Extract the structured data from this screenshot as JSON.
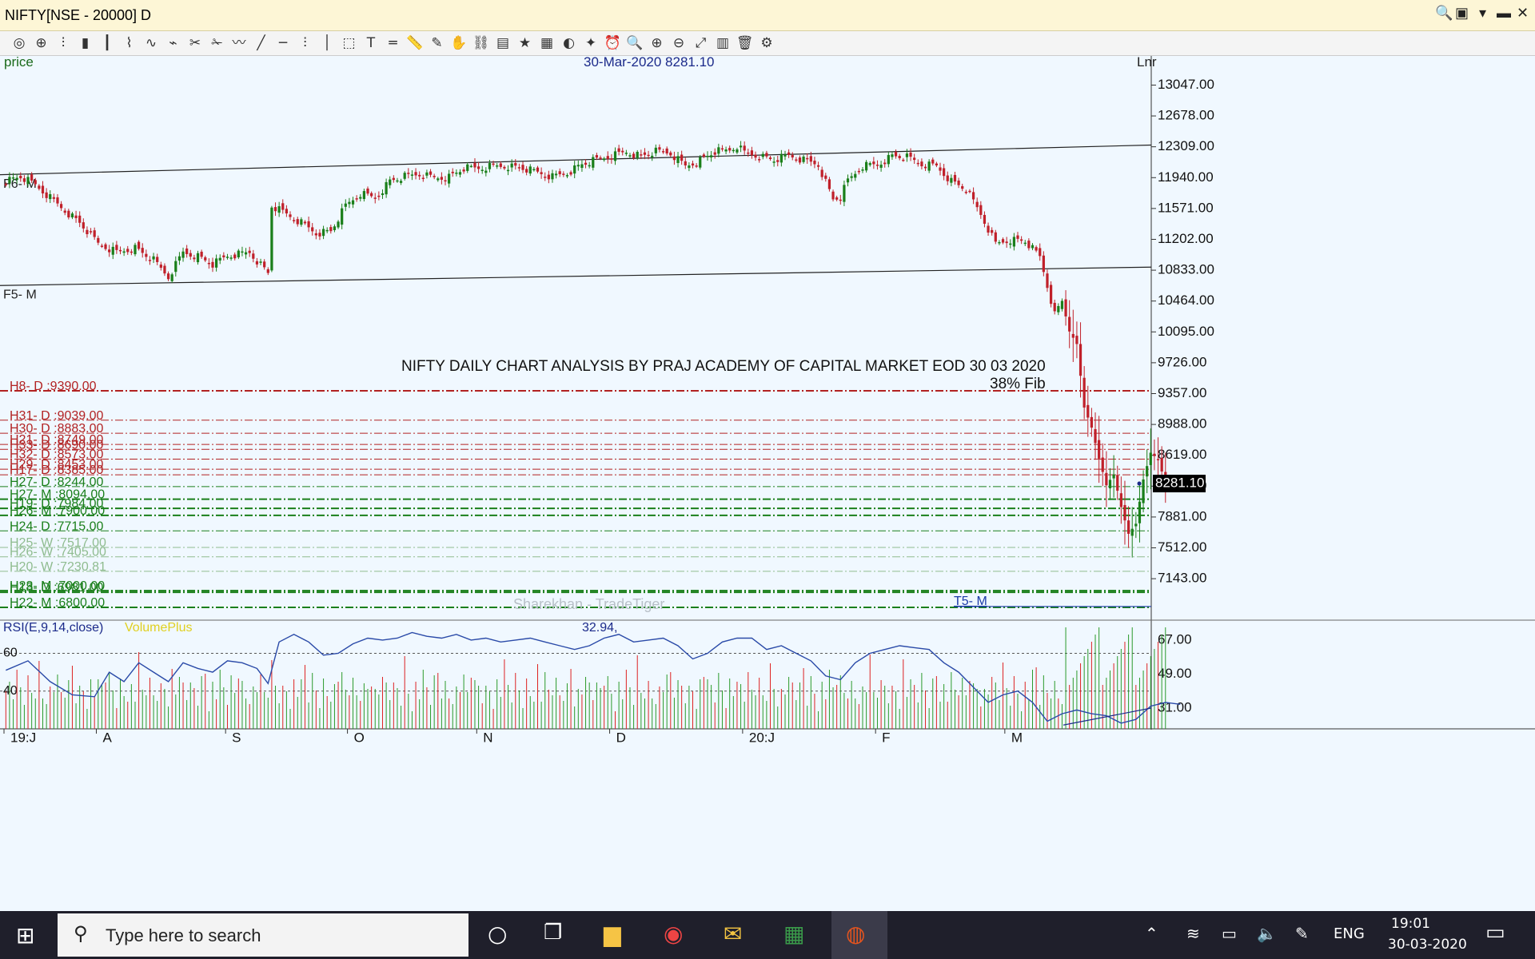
{
  "window": {
    "title": "NIFTY[NSE - 20000] D",
    "controls": [
      "search-icon",
      "user-icon",
      "menu-icon",
      "restore-icon",
      "close-icon"
    ]
  },
  "toolbar": {
    "icons": [
      "crosshair-icon",
      "target-icon",
      "bar-chart-icon",
      "candles-icon",
      "ohlc-icon",
      "line-chart-icon",
      "scatter-icon",
      "area-icon",
      "tools-icon",
      "cut-icon",
      "wave-icon",
      "trendline-icon",
      "hline-icon",
      "fib-icon",
      "vline-icon",
      "cube-icon",
      "text-icon",
      "channel-icon",
      "ruler-icon",
      "pen-icon",
      "hand-icon",
      "link-icon",
      "layers-icon",
      "star-icon",
      "templates-icon",
      "globe-icon",
      "wand-icon",
      "alarm-icon",
      "zoom-icon",
      "zoom-in-icon",
      "zoom-out-icon",
      "zoom-fit-icon",
      "indicator-icon",
      "delete-icon",
      "settings-icon"
    ]
  },
  "chart_data": {
    "type": "candlestick",
    "price_label": "price",
    "header": "30-Mar-2020 8281.10",
    "scale_label": "Lnr",
    "last_price": "8281.10",
    "title": "NIFTY DAILY CHART ANALYSIS BY PRAJ ACADEMY OF CAPITAL MARKET EOD 30 03 2020",
    "watermark": "Sharekhan - TradeTiger",
    "fib_annotation": "38% Fib",
    "y_ticks": [
      "13047.00",
      "12678.00",
      "12309.00",
      "11940.00",
      "11571.00",
      "11202.00",
      "10833.00",
      "10464.00",
      "10095.00",
      "9726.00",
      "9357.00",
      "8988.00",
      "8619.00",
      "8250.00",
      "7881.00",
      "7512.00",
      "7143.00"
    ],
    "ylim": [
      6800,
      13300
    ],
    "x_ticks": [
      "19:J",
      "A",
      "S",
      "O",
      "N",
      "D",
      "20:J",
      "F",
      "M"
    ],
    "x_tick_bars": [
      0,
      25,
      60,
      93,
      128,
      164,
      200,
      236,
      271
    ],
    "n_bars": 310,
    "trendlines": [
      {
        "label": "F6- M",
        "y_start": 11975,
        "y_end": 12330
      },
      {
        "label": "F5- M",
        "y_start": 10650,
        "y_end": 10870
      },
      {
        "label": "T5- M",
        "y_start": 6810,
        "y_end": 6810
      }
    ],
    "levels": [
      {
        "label": "H8- D :9390.00",
        "value": 9390.0,
        "color": "#b22222",
        "style": "dashdot",
        "w": 2
      },
      {
        "label": "H31- D :9039.00",
        "value": 9039.0,
        "color": "#b22222",
        "style": "dashdot",
        "w": 1
      },
      {
        "label": "H30- D :8883.00",
        "value": 8883.0,
        "color": "#b22222",
        "style": "dashdot",
        "w": 1
      },
      {
        "label": "H21- D :8749.00",
        "value": 8749.0,
        "color": "#b22222",
        "style": "dashdot",
        "w": 1
      },
      {
        "label": "H33- D :8690.00",
        "value": 8690.0,
        "color": "#b22222",
        "style": "dashdot",
        "w": 1
      },
      {
        "label": "H32- D :8573.00",
        "value": 8573.0,
        "color": "#b22222",
        "style": "dashdot",
        "w": 1
      },
      {
        "label": "H29- D :8453.00",
        "value": 8453.0,
        "color": "#b22222",
        "style": "dashdot",
        "w": 1
      },
      {
        "label": "H17- D :8385.00",
        "value": 8385.0,
        "color": "#b22222",
        "style": "dashdot",
        "w": 1
      },
      {
        "label": "H27- D :8244.00",
        "value": 8244.0,
        "color": "#1a7f1a",
        "style": "dashdot",
        "w": 1
      },
      {
        "label": "H27- M :8094.00",
        "value": 8094.0,
        "color": "#1a7f1a",
        "style": "dashdot",
        "w": 2
      },
      {
        "label": "H19- D :7984.00",
        "value": 7984.0,
        "color": "#1a7f1a",
        "style": "dashdot",
        "w": 2
      },
      {
        "label": "H26- M :7900.00",
        "value": 7900.0,
        "color": "#1a7f1a",
        "style": "dashdot",
        "w": 2
      },
      {
        "label": "H24- D :7715.00",
        "value": 7715.0,
        "color": "#1a7f1a",
        "style": "dashdot",
        "w": 1
      },
      {
        "label": "H25- W :7517.00",
        "value": 7517.0,
        "color": "#8fbc8f",
        "style": "dashdot",
        "w": 1
      },
      {
        "label": "H26- W :7405.00",
        "value": 7405.0,
        "color": "#8fbc8f",
        "style": "dashdot",
        "w": 1
      },
      {
        "label": "H20- W :7230.81",
        "value": 7230.81,
        "color": "#8fbc8f",
        "style": "dashdot",
        "w": 1
      },
      {
        "label": "H23- M :7000.00",
        "value": 7000.0,
        "color": "#1a7f1a",
        "style": "dashdot",
        "w": 2
      },
      {
        "label": "H18- D :6981.00",
        "value": 6981.0,
        "color": "#1a7f1a",
        "style": "dashdot",
        "w": 2
      },
      {
        "label": "H22- M :6800.00",
        "value": 6800.0,
        "color": "#1a7f1a",
        "style": "dashdot",
        "w": 2
      }
    ],
    "anchor_closes": [
      [
        0,
        11900
      ],
      [
        4,
        11950
      ],
      [
        8,
        11850
      ],
      [
        12,
        11700
      ],
      [
        16,
        11550
      ],
      [
        20,
        11400
      ],
      [
        25,
        11150
      ],
      [
        30,
        11050
      ],
      [
        35,
        11100
      ],
      [
        40,
        10950
      ],
      [
        44,
        10750
      ],
      [
        48,
        11050
      ],
      [
        52,
        11000
      ],
      [
        56,
        10900
      ],
      [
        60,
        11000
      ],
      [
        66,
        11050
      ],
      [
        71,
        10800
      ],
      [
        72,
        11600
      ],
      [
        76,
        11500
      ],
      [
        80,
        11400
      ],
      [
        84,
        11280
      ],
      [
        88,
        11300
      ],
      [
        92,
        11600
      ],
      [
        96,
        11750
      ],
      [
        100,
        11700
      ],
      [
        104,
        11900
      ],
      [
        108,
        11950
      ],
      [
        112,
        11980
      ],
      [
        116,
        11940
      ],
      [
        120,
        11950
      ],
      [
        124,
        12050
      ],
      [
        128,
        12050
      ],
      [
        132,
        12080
      ],
      [
        136,
        12080
      ],
      [
        140,
        12050
      ],
      [
        144,
        12000
      ],
      [
        148,
        11950
      ],
      [
        152,
        12000
      ],
      [
        156,
        12100
      ],
      [
        160,
        12150
      ],
      [
        164,
        12200
      ],
      [
        168,
        12250
      ],
      [
        172,
        12200
      ],
      [
        176,
        12250
      ],
      [
        180,
        12230
      ],
      [
        184,
        12080
      ],
      [
        188,
        12150
      ],
      [
        192,
        12250
      ],
      [
        196,
        12270
      ],
      [
        198,
        12320
      ],
      [
        200,
        12240
      ],
      [
        204,
        12200
      ],
      [
        208,
        12150
      ],
      [
        212,
        12200
      ],
      [
        216,
        12150
      ],
      [
        220,
        12100
      ],
      [
        224,
        11680
      ],
      [
        226,
        11710
      ],
      [
        228,
        11900
      ],
      [
        232,
        12080
      ],
      [
        236,
        12100
      ],
      [
        240,
        12200
      ],
      [
        244,
        12180
      ],
      [
        248,
        12100
      ],
      [
        252,
        12080
      ],
      [
        256,
        11900
      ],
      [
        260,
        11800
      ],
      [
        264,
        11500
      ],
      [
        268,
        11150
      ],
      [
        272,
        11200
      ],
      [
        276,
        11180
      ],
      [
        280,
        10990
      ],
      [
        284,
        10300
      ],
      [
        286,
        10460
      ],
      [
        288,
        10100
      ],
      [
        290,
        9950
      ],
      [
        292,
        9190
      ],
      [
        294,
        8950
      ],
      [
        296,
        8580
      ],
      [
        298,
        8260
      ],
      [
        300,
        8390
      ],
      [
        302,
        8000
      ],
      [
        304,
        7680
      ],
      [
        306,
        7800
      ],
      [
        308,
        8330
      ],
      [
        310,
        8650
      ],
      [
        312,
        8570
      ],
      [
        314,
        8281
      ]
    ],
    "rsi": {
      "label": "RSI(E,9,14,close)",
      "volume_label": "VolumePlus",
      "value": "32.94,",
      "level_labels": [
        "60",
        "40"
      ],
      "ticks": [
        "67.00",
        "49.00",
        "31.00"
      ],
      "ylim": [
        20,
        75
      ],
      "anchors": [
        [
          0,
          51
        ],
        [
          6,
          56
        ],
        [
          12,
          45
        ],
        [
          18,
          38
        ],
        [
          24,
          37
        ],
        [
          28,
          50
        ],
        [
          32,
          45
        ],
        [
          36,
          55
        ],
        [
          40,
          50
        ],
        [
          44,
          45
        ],
        [
          48,
          55
        ],
        [
          52,
          52
        ],
        [
          56,
          50
        ],
        [
          60,
          56
        ],
        [
          64,
          55
        ],
        [
          68,
          52
        ],
        [
          71,
          44
        ],
        [
          74,
          66
        ],
        [
          78,
          70
        ],
        [
          82,
          66
        ],
        [
          86,
          59
        ],
        [
          90,
          60
        ],
        [
          94,
          65
        ],
        [
          98,
          68
        ],
        [
          102,
          67
        ],
        [
          106,
          68
        ],
        [
          110,
          71
        ],
        [
          114,
          69
        ],
        [
          118,
          68
        ],
        [
          122,
          70
        ],
        [
          126,
          67
        ],
        [
          130,
          68
        ],
        [
          134,
          66
        ],
        [
          138,
          67
        ],
        [
          142,
          68
        ],
        [
          146,
          66
        ],
        [
          150,
          64
        ],
        [
          154,
          62
        ],
        [
          158,
          64
        ],
        [
          162,
          68
        ],
        [
          166,
          70
        ],
        [
          170,
          66
        ],
        [
          174,
          67
        ],
        [
          178,
          68
        ],
        [
          182,
          64
        ],
        [
          186,
          57
        ],
        [
          190,
          60
        ],
        [
          194,
          66
        ],
        [
          198,
          68
        ],
        [
          202,
          68
        ],
        [
          206,
          62
        ],
        [
          210,
          64
        ],
        [
          214,
          60
        ],
        [
          218,
          56
        ],
        [
          222,
          48
        ],
        [
          226,
          46
        ],
        [
          230,
          55
        ],
        [
          234,
          60
        ],
        [
          238,
          62
        ],
        [
          242,
          64
        ],
        [
          246,
          63
        ],
        [
          250,
          62
        ],
        [
          254,
          55
        ],
        [
          258,
          50
        ],
        [
          262,
          42
        ],
        [
          266,
          34
        ],
        [
          270,
          38
        ],
        [
          274,
          40
        ],
        [
          278,
          34
        ],
        [
          282,
          24
        ],
        [
          286,
          28
        ],
        [
          290,
          30
        ],
        [
          294,
          28
        ],
        [
          298,
          27
        ],
        [
          302,
          23
        ],
        [
          306,
          25
        ],
        [
          310,
          32
        ],
        [
          314,
          34
        ],
        [
          318,
          33
        ]
      ]
    }
  }
}
